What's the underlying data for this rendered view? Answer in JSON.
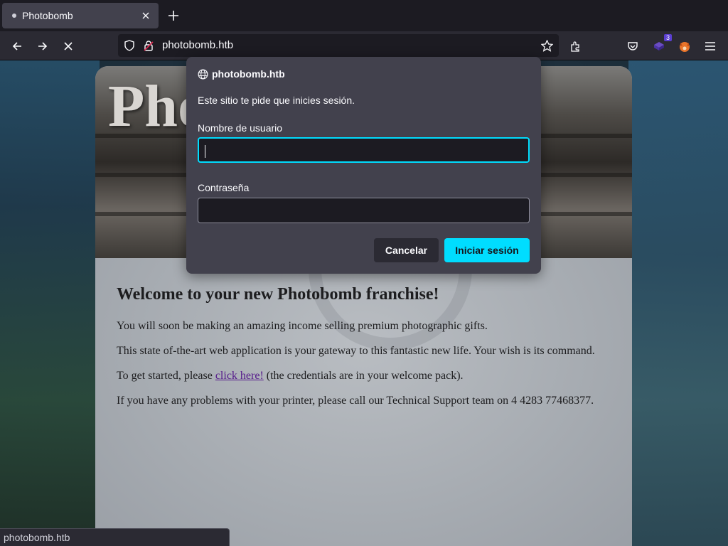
{
  "browser": {
    "tab": {
      "title": "Photobomb"
    },
    "url": "photobomb.htb",
    "status_text": "photobomb.htb",
    "extension_badge": "3"
  },
  "dialog": {
    "host": "photobomb.htb",
    "message": "Este sitio te pide que inicies sesión.",
    "username_label": "Nombre de usuario",
    "username_value": "",
    "password_label": "Contraseña",
    "password_value": "",
    "cancel_label": "Cancelar",
    "submit_label": "Iniciar sesión"
  },
  "page": {
    "hero_title": "Photobomb",
    "heading": "Welcome to your new Photobomb franchise!",
    "p1": "You will soon be making an amazing income selling premium photographic gifts.",
    "p2": "This state of-the-art web application is your gateway to this fantastic new life. Your wish is its command.",
    "p3_before": "To get started, please ",
    "p3_link": "click here!",
    "p3_after": " (the credentials are in your welcome pack).",
    "p4": "If you have any problems with your printer, please call our Technical Support team on 4 4283 77468377."
  },
  "colors": {
    "accent": "#00ddff",
    "dialog_bg": "#42414d",
    "toolbar_bg": "#2b2a33"
  }
}
